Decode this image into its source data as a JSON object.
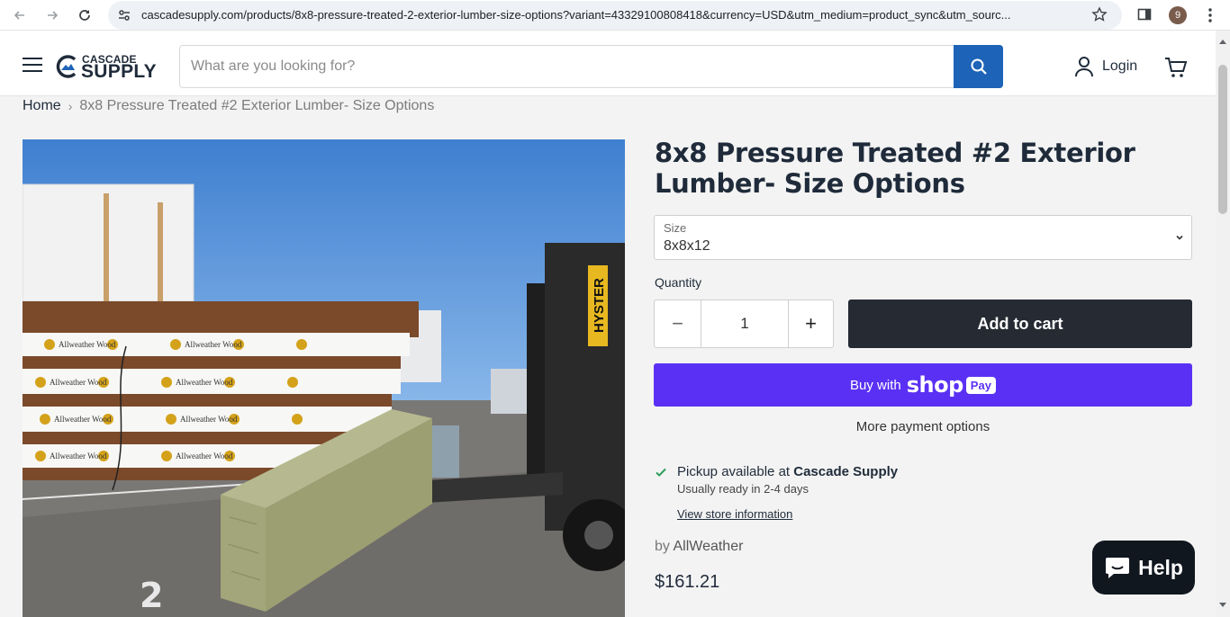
{
  "browser": {
    "url": "cascadesupply.com/products/8x8-pressure-treated-2-exterior-lumber-size-options?variant=43329100808418&currency=USD&utm_medium=product_sync&utm_sourc...",
    "avatar_initial": "9"
  },
  "header": {
    "logo_top": "CASCADE",
    "logo_bottom": "SUPPLY",
    "search_placeholder": "What are you looking for?",
    "login_label": "Login"
  },
  "breadcrumb": {
    "home": "Home",
    "separator": "›",
    "current": "8x8 Pressure Treated #2 Exterior Lumber- Size Options"
  },
  "product": {
    "title": "8x8 Pressure Treated #2 Exterior Lumber- Size Options",
    "size_label": "Size",
    "size_value": "8x8x12",
    "quantity_label": "Quantity",
    "quantity_value": "1",
    "minus_symbol": "−",
    "plus_symbol": "+",
    "add_to_cart": "Add to cart",
    "buy_with": "Buy with",
    "shop_word": "shop",
    "pay_word": "Pay",
    "more_payment": "More payment options",
    "pickup_prefix": "Pickup available at ",
    "pickup_location": "Cascade Supply",
    "pickup_ready": "Usually ready in 2-4 days",
    "store_info_link": "View store information",
    "vendor_prefix": "by ",
    "vendor_name": "AllWeather",
    "price": "$161.21"
  },
  "image_labels": {
    "wrap_brand": "Allweather Wood",
    "forklift_brand": "HYSTER",
    "ground_marking": "2"
  },
  "help": {
    "label": "Help"
  },
  "colors": {
    "accent_blue": "#1d63b8",
    "shop_pay_purple": "#5a31f4",
    "dark_button": "#252a33",
    "pickup_check": "#2e9e5b"
  }
}
